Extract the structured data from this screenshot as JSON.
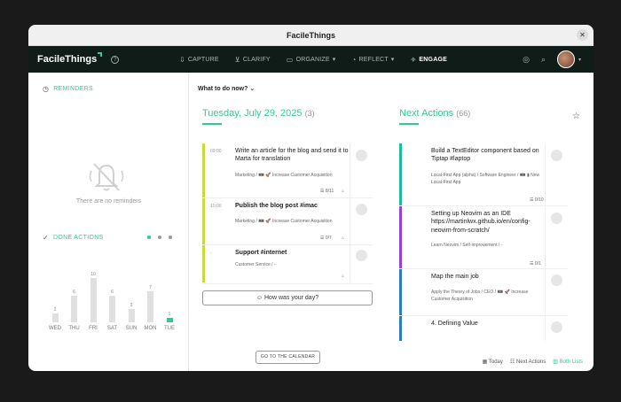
{
  "window": {
    "title": "FacileThings"
  },
  "nav": {
    "logo": "FacileThings",
    "items": [
      {
        "label": "CAPTURE",
        "icon": "inbox-icon"
      },
      {
        "label": "CLARIFY",
        "icon": "funnel-icon"
      },
      {
        "label": "ORGANIZE",
        "icon": "folder-icon"
      },
      {
        "label": "REFLECT",
        "icon": "bulb-icon"
      },
      {
        "label": "ENGAGE",
        "icon": "compass-icon"
      }
    ]
  },
  "sidebar": {
    "reminders_label": "REMINDERS",
    "no_reminders": "There are no reminders",
    "done_label": "DONE ACTIONS",
    "days": [
      {
        "label": "WED",
        "value": "2",
        "n": 2
      },
      {
        "label": "THU",
        "value": "6",
        "n": 6
      },
      {
        "label": "FRI",
        "value": "10",
        "n": 10
      },
      {
        "label": "SAT",
        "value": "6",
        "n": 6
      },
      {
        "label": "SUN",
        "value": "3",
        "n": 3
      },
      {
        "label": "MON",
        "value": "7",
        "n": 7
      },
      {
        "label": "TUE",
        "value": "1",
        "n": 1
      }
    ]
  },
  "main": {
    "what_to_do": "What to do now?",
    "today_title": "Tuesday, July 29, 2025",
    "today_count": "(3)",
    "next_title": "Next Actions",
    "next_count": "(66)",
    "today_tasks": [
      {
        "time": "09:00",
        "title": "Write an article for the blog and send it to Marta for translation",
        "meta": "Marketing / 🀰 🚀 Increase Customer Acquisition",
        "count": "☰ 8/11"
      },
      {
        "time": "10:00",
        "title": "Publish the blog post #imac",
        "meta": "Marketing / 🀰 🚀 Increase Customer Acquisition",
        "count": "☰ 0/7"
      },
      {
        "time": "-",
        "title": "Support #internet",
        "meta": "Customer Service / -",
        "count": ""
      }
    ],
    "next_tasks": [
      {
        "title": "Build a TextEditor component based on Tiptap #laptop",
        "meta": "Local-First App (alpha) / Software Engineer / 🀰 ▮ New Local-First App",
        "count": "☰ 0/10",
        "color": "#1abc9c"
      },
      {
        "title": "Setting up Neovim as an IDE https://martinlwx.github.io/en/config-neovim-from-scratch/",
        "meta": "Learn Neovim / Self-improvement / -",
        "count": "☰ 0/1",
        "color": "#9b3fd6"
      },
      {
        "title": "Map the main job",
        "meta": "Apply the Theory of Jobs / CEO / 🀰 🚀 Increase Customer Acquisition",
        "count": "",
        "color": "#2a7fb8"
      },
      {
        "title": "4. Defining Value",
        "meta": "",
        "count": "",
        "color": "#2a7fb8"
      }
    ],
    "how_was_day": "How was your day?",
    "go_calendar": "GO TO THE CALENDAR",
    "views": {
      "today": "Today",
      "next": "Next Actions",
      "both": "Both Lists"
    }
  }
}
